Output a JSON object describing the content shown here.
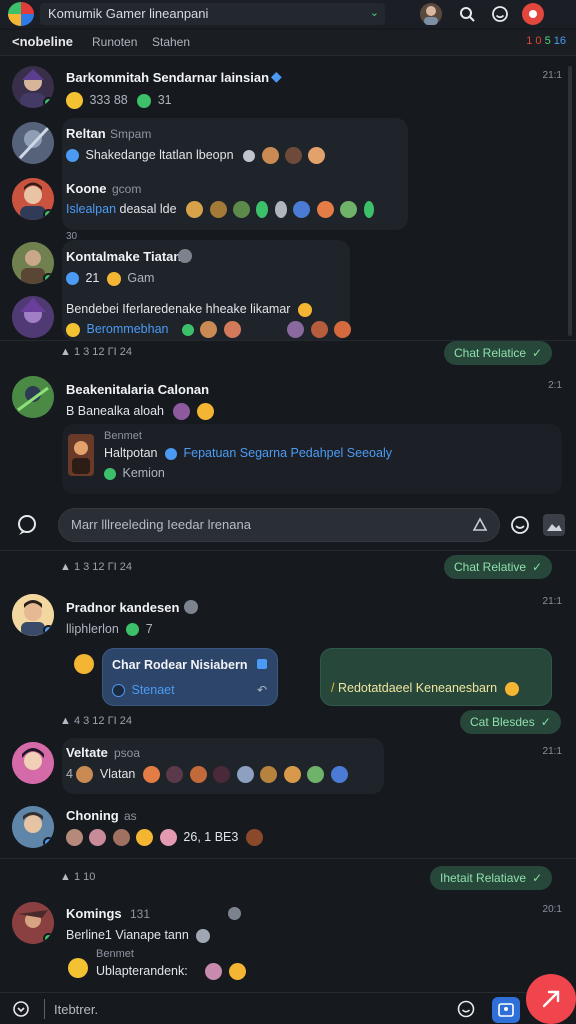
{
  "topbar": {
    "title": "Komumik Gamer lineanpani",
    "chevron": "⌄"
  },
  "tabrow": {
    "back": "<nobeline",
    "tab1": "Runoten",
    "tab2": "Stahen",
    "counts": "1 0 5 16",
    "count_a": "1",
    "count_b": "0",
    "count_c": "5",
    "count_d": "16"
  },
  "messages": [
    {
      "name": "Barkommitah Sendarnar lainsian",
      "time": "21:1",
      "meta": "333 88",
      "meta2": "31"
    },
    {
      "name": "Reltan",
      "sub": "Smpam",
      "text": "Shakedange ltatlan lbeopn"
    },
    {
      "name": "Koone",
      "sub": "gcom",
      "text_link": "Islealpan",
      "text": "deasal lde"
    },
    {
      "name": "Kontalmake Tiatan",
      "sub": "21",
      "sub2": "Gam",
      "num": "21"
    },
    {
      "name": "Bendebei Iferlaredenake hheake likamar",
      "link": "Berommebhan"
    },
    {
      "reacts": "1 3 12 ΓΙ 24",
      "pill": "Chat Relatice"
    },
    {
      "name": "Beakenitalaria Calonan",
      "time": "2:1",
      "text": "B Banealka aloah",
      "quote_title": "Benmet",
      "quote_text": "Haltpotan",
      "quote_link": "Fepatuan Segarna Pedahpel Seeoaly",
      "quote_sub": "Kemion"
    },
    {
      "reacts": "1 3 12 ΓΙ 24",
      "pill": "Chat Relative"
    },
    {
      "name": "Pradnor kandesen",
      "time": "21:1",
      "sub": "lliphlerlon",
      "sub_num": "7",
      "card1_title": "Char Rodear Nisiabern",
      "card1_sub": "Stenaet",
      "card2_text": "Redotatdaeel Keneanesbarn"
    },
    {
      "reacts": "4 3 12 ΓΙ 24",
      "pill": "Cat Blesdes"
    },
    {
      "name": "Veltate",
      "sub": "psoa",
      "time": "21:1",
      "text": "Vlatan"
    },
    {
      "name": "Choning",
      "sub": "as",
      "text": "26, 1 BE3"
    },
    {
      "reacts": "1 10",
      "pill": "Ihetait Relatiave"
    },
    {
      "name": "Komings",
      "sub": "131",
      "time": "20:1",
      "text": "Berline1 Vianape tann",
      "quote_title": "Benmet",
      "quote_text": "Ublapterandenk:"
    }
  ],
  "composer": {
    "placeholder": "Marr lllreeleding Ieedar lrenana"
  },
  "bottombar": {
    "placeholder": "Itebtrer."
  },
  "colors": {
    "accent": "#3cc06a",
    "link": "#4b9bf5",
    "pill_bg": "#26473a",
    "fab": "#f0454d"
  },
  "icons": [
    "logo-icon",
    "avatar-icon",
    "search-icon",
    "smiley-icon",
    "notification-icon",
    "chat-icon",
    "emoji-icon",
    "image-icon",
    "send-icon",
    "add-icon"
  ]
}
